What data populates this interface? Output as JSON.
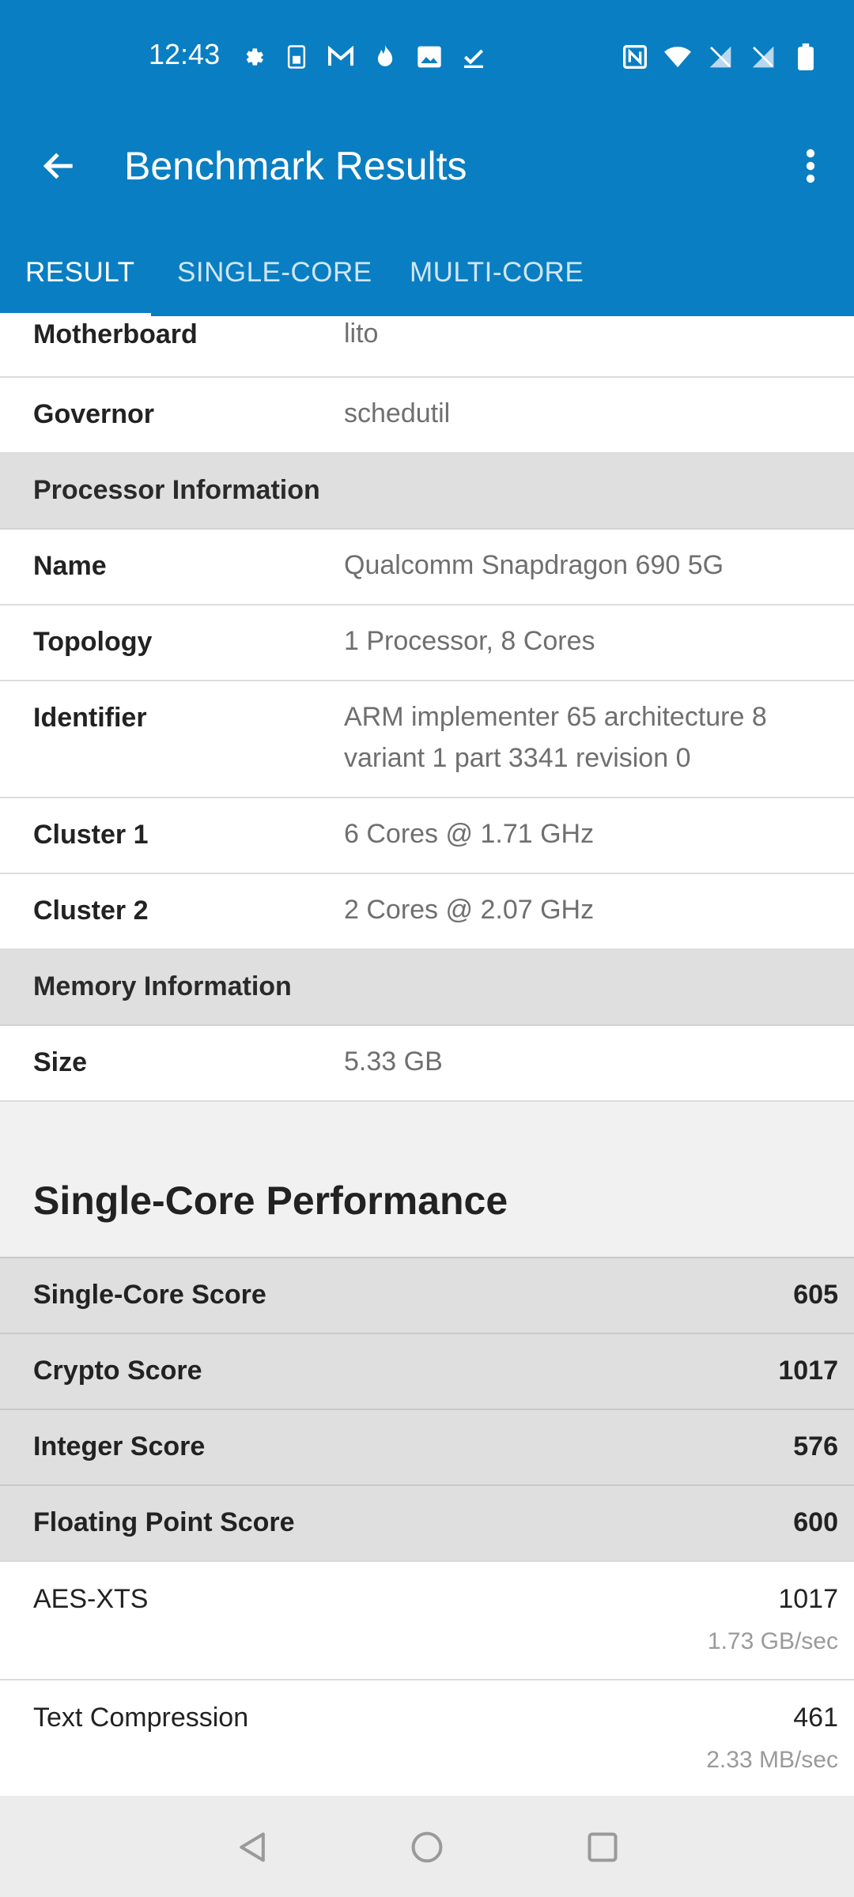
{
  "status_bar": {
    "time": "12:43",
    "left_icons": [
      "settings-icon",
      "sim-icon",
      "gmail-icon",
      "fire-icon",
      "image-icon",
      "check-icon"
    ],
    "right_icons": [
      "nfc-icon",
      "wifi-icon",
      "signal-off-icon",
      "signal-off-icon",
      "battery-icon"
    ]
  },
  "app_bar": {
    "title": "Benchmark Results",
    "back_icon": "arrow-left-icon",
    "menu_icon": "more-vert-icon"
  },
  "tabs": [
    {
      "label": "RESULT",
      "active": true
    },
    {
      "label": "SINGLE-CORE",
      "active": false
    },
    {
      "label": "MULTI-CORE",
      "active": false
    }
  ],
  "system_rows": [
    {
      "key": "Motherboard",
      "value": "lito"
    },
    {
      "key": "Governor",
      "value": "schedutil"
    }
  ],
  "processor_section": {
    "header": "Processor Information",
    "rows": [
      {
        "key": "Name",
        "value": "Qualcomm Snapdragon 690 5G"
      },
      {
        "key": "Topology",
        "value": "1 Processor, 8 Cores"
      },
      {
        "key": "Identifier",
        "value": "ARM implementer 65 architecture 8 variant 1 part 3341 revision 0"
      },
      {
        "key": "Cluster 1",
        "value": "6 Cores @ 1.71 GHz"
      },
      {
        "key": "Cluster 2",
        "value": "2 Cores @ 2.07 GHz"
      }
    ]
  },
  "memory_section": {
    "header": "Memory Information",
    "rows": [
      {
        "key": "Size",
        "value": "5.33 GB"
      }
    ]
  },
  "single_core": {
    "title": "Single-Core Performance",
    "scores": [
      {
        "label": "Single-Core Score",
        "value": "605"
      },
      {
        "label": "Crypto Score",
        "value": "1017"
      },
      {
        "label": "Integer Score",
        "value": "576"
      },
      {
        "label": "Floating Point Score",
        "value": "600"
      }
    ],
    "benchmarks": [
      {
        "label": "AES-XTS",
        "value": "1017",
        "rate": "1.73 GB/sec"
      },
      {
        "label": "Text Compression",
        "value": "461",
        "rate": "2.33 MB/sec"
      }
    ]
  },
  "nav_bar": {
    "buttons": [
      "back-triangle-icon",
      "home-circle-icon",
      "recents-square-icon"
    ]
  },
  "colors": {
    "primary": "#0a7ec2",
    "section_bg": "#dfdfdf",
    "value_text": "#6f6f6f"
  }
}
